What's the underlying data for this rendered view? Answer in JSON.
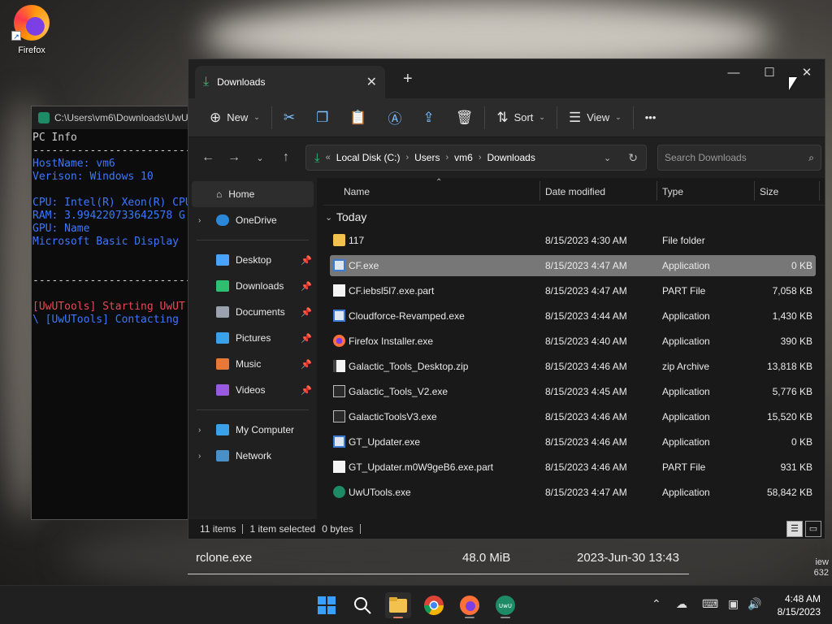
{
  "desktop": {
    "firefox_label": "Firefox"
  },
  "terminal": {
    "title": "C:\\Users\\vm6\\Downloads\\UwU",
    "lines": [
      {
        "text": "PC Info",
        "color": "white"
      },
      {
        "text": "------------------------------",
        "color": "white"
      },
      {
        "text": "HostName: vm6",
        "color": "blue"
      },
      {
        "text": "Verison: Windows 10",
        "color": "blue"
      },
      {
        "text": "",
        "color": "blue"
      },
      {
        "text": "CPU: Intel(R) Xeon(R) CPU",
        "color": "blue"
      },
      {
        "text": "RAM: 3.994220733642578 G",
        "color": "blue"
      },
      {
        "text": "GPU: Name",
        "color": "blue"
      },
      {
        "text": "Microsoft Basic Display",
        "color": "blue"
      },
      {
        "text": "",
        "color": "blue"
      },
      {
        "text": "",
        "color": "blue"
      },
      {
        "text": "------------------------------",
        "color": "white"
      },
      {
        "text": "",
        "color": "white"
      },
      {
        "text": "[UwUTools] Starting UwUT",
        "color": "red"
      },
      {
        "text": "\\ [UwUTools] Contacting",
        "color": "blue"
      }
    ]
  },
  "background_window": {
    "file_name": "rclone.exe",
    "size": "48.0 MiB",
    "date": "2023-Jun-30 13:43",
    "side_text_1": "iew",
    "side_text_2": "632"
  },
  "explorer": {
    "tab_title": "Downloads",
    "new_tab": "+",
    "window_buttons": {
      "minimize": "—",
      "maximize": "☐",
      "close": "✕"
    },
    "toolbar": {
      "new_label": "New",
      "sort_label": "Sort",
      "view_label": "View",
      "more_label": "•••"
    },
    "address": {
      "overflow": "«",
      "crumbs": [
        "Local Disk (C:)",
        "Users",
        "vm6",
        "Downloads"
      ]
    },
    "search_placeholder": "Search Downloads",
    "sidebar": {
      "home": "Home",
      "onedrive": "OneDrive",
      "quick": [
        {
          "label": "Desktop",
          "color": "#4aa3ff"
        },
        {
          "label": "Downloads",
          "color": "#2fbf71"
        },
        {
          "label": "Documents",
          "color": "#9aa4b0"
        },
        {
          "label": "Pictures",
          "color": "#3aa0e8"
        },
        {
          "label": "Music",
          "color": "#e8773a"
        },
        {
          "label": "Videos",
          "color": "#9a5ae0"
        }
      ],
      "my_computer": "My Computer",
      "network": "Network"
    },
    "columns": {
      "name": "Name",
      "date": "Date modified",
      "type": "Type",
      "size": "Size"
    },
    "group": "Today",
    "files": [
      {
        "name": "117",
        "date": "8/15/2023 4:30 AM",
        "type": "File folder",
        "size": "",
        "icon": "folder"
      },
      {
        "name": "CF.exe",
        "date": "8/15/2023 4:47 AM",
        "type": "Application",
        "size": "0 KB",
        "icon": "app"
      },
      {
        "name": "CF.iebsl5l7.exe.part",
        "date": "8/15/2023 4:47 AM",
        "type": "PART File",
        "size": "7,058 KB",
        "icon": "doc"
      },
      {
        "name": "Cloudforce-Revamped.exe",
        "date": "8/15/2023 4:44 AM",
        "type": "Application",
        "size": "1,430 KB",
        "icon": "app"
      },
      {
        "name": "Firefox Installer.exe",
        "date": "8/15/2023 4:40 AM",
        "type": "Application",
        "size": "390 KB",
        "icon": "firefox"
      },
      {
        "name": "Galactic_Tools_Desktop.zip",
        "date": "8/15/2023 4:46 AM",
        "type": "zip Archive",
        "size": "13,818 KB",
        "icon": "zip"
      },
      {
        "name": "Galactic_Tools_V2.exe",
        "date": "8/15/2023 4:45 AM",
        "type": "Application",
        "size": "5,776 KB",
        "icon": "dark"
      },
      {
        "name": "GalacticToolsV3.exe",
        "date": "8/15/2023 4:46 AM",
        "type": "Application",
        "size": "15,520 KB",
        "icon": "dark"
      },
      {
        "name": "GT_Updater.exe",
        "date": "8/15/2023 4:46 AM",
        "type": "Application",
        "size": "0 KB",
        "icon": "app"
      },
      {
        "name": "GT_Updater.m0W9geB6.exe.part",
        "date": "8/15/2023 4:46 AM",
        "type": "PART File",
        "size": "931 KB",
        "icon": "doc"
      },
      {
        "name": "UwUTools.exe",
        "date": "8/15/2023 4:47 AM",
        "type": "Application",
        "size": "58,842 KB",
        "icon": "uwu"
      }
    ],
    "selected_index": 1,
    "status": {
      "items": "11 items",
      "selected": "1 item selected",
      "bytes": "0 bytes"
    }
  },
  "taskbar": {
    "time": "4:48 AM",
    "date": "8/15/2023"
  }
}
